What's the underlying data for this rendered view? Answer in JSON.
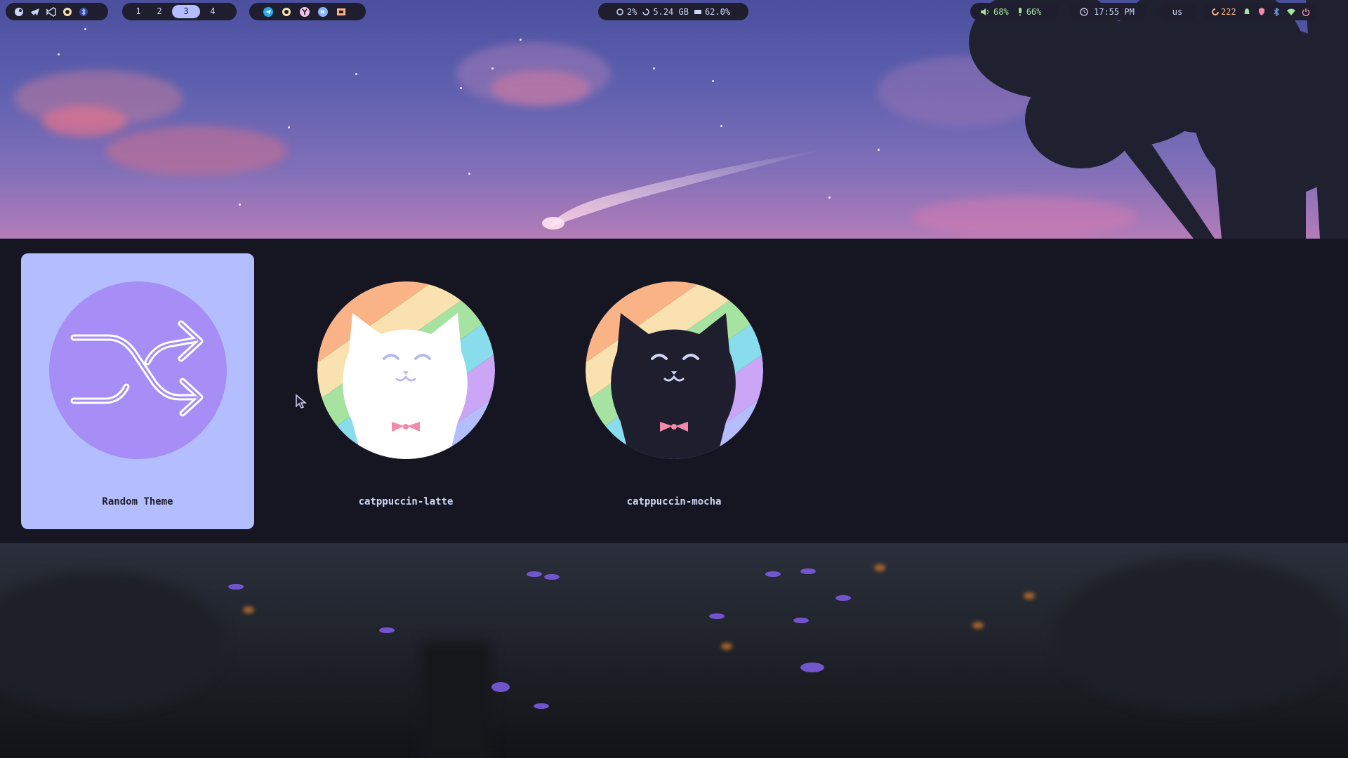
{
  "topbar": {
    "left_apps": [
      "steam-icon",
      "telegram-icon",
      "vscode-icon",
      "sun-app-icon",
      "bluetooth-icon"
    ],
    "workspaces": [
      {
        "label": "1",
        "active": false
      },
      {
        "label": "2",
        "active": false
      },
      {
        "label": "3",
        "active": true
      },
      {
        "label": "4",
        "active": false
      }
    ],
    "tray_apps": [
      "telegram-icon",
      "sun-app-icon",
      "yandex-icon",
      "vscode-icon",
      "files-icon"
    ],
    "system": {
      "cpu": "2%",
      "memory": "5.24 GB",
      "storage": "62.0%"
    },
    "audio": {
      "volume": "68%",
      "mic": "66%"
    },
    "clock": "17:55 PM",
    "keyboard_layout": "us",
    "status": {
      "updates": "222"
    },
    "status_icons": [
      "update-icon",
      "notification-bell-icon",
      "shield-icon",
      "bluetooth-icon",
      "wifi-icon",
      "power-icon"
    ]
  },
  "theme_selector": {
    "items": [
      {
        "label": "Random Theme",
        "selected": true,
        "icon": "shuffle-icon"
      },
      {
        "label": "catppuccin-latte",
        "selected": false,
        "icon": "latte-cat-icon"
      },
      {
        "label": "catppuccin-mocha",
        "selected": false,
        "icon": "mocha-cat-icon"
      }
    ]
  },
  "colors": {
    "bar_bg": "#1e1e2e",
    "accent": "#b4befe",
    "panel_bg": "#161622",
    "text": "#cdd6f4",
    "green": "#a6e3a1",
    "peach": "#fab387",
    "red": "#f38ba8",
    "mauve": "#a78bfa"
  }
}
